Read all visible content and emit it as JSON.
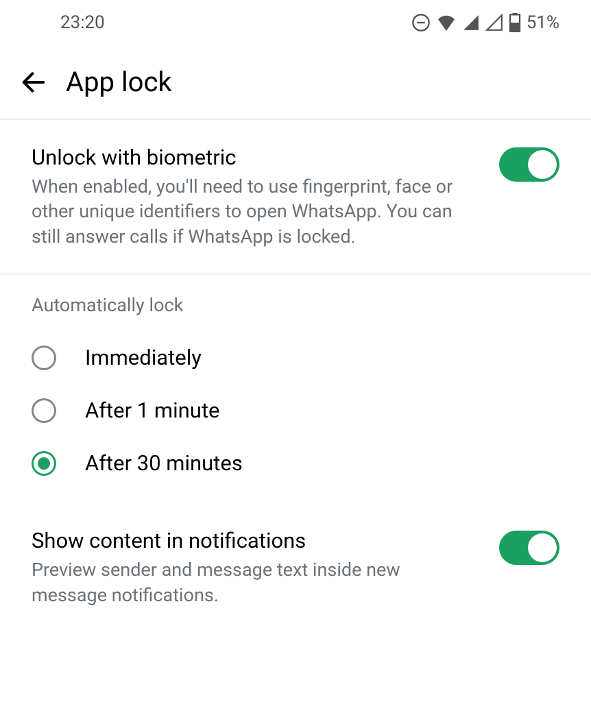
{
  "statusBar": {
    "time": "23:20",
    "battery": "51%"
  },
  "header": {
    "title": "App lock"
  },
  "biometric": {
    "title": "Unlock with biometric",
    "description": "When enabled, you'll need to use fingerprint, face or other unique identifiers to open WhatsApp. You can still answer calls if WhatsApp is locked.",
    "enabled": true
  },
  "autoLock": {
    "sectionTitle": "Automatically lock",
    "options": [
      {
        "label": "Immediately",
        "selected": false
      },
      {
        "label": "After 1 minute",
        "selected": false
      },
      {
        "label": "After 30 minutes",
        "selected": true
      }
    ]
  },
  "notifications": {
    "title": "Show content in notifications",
    "description": "Preview sender and message text inside new message notifications.",
    "enabled": true
  },
  "colors": {
    "accent": "#1ba060"
  }
}
